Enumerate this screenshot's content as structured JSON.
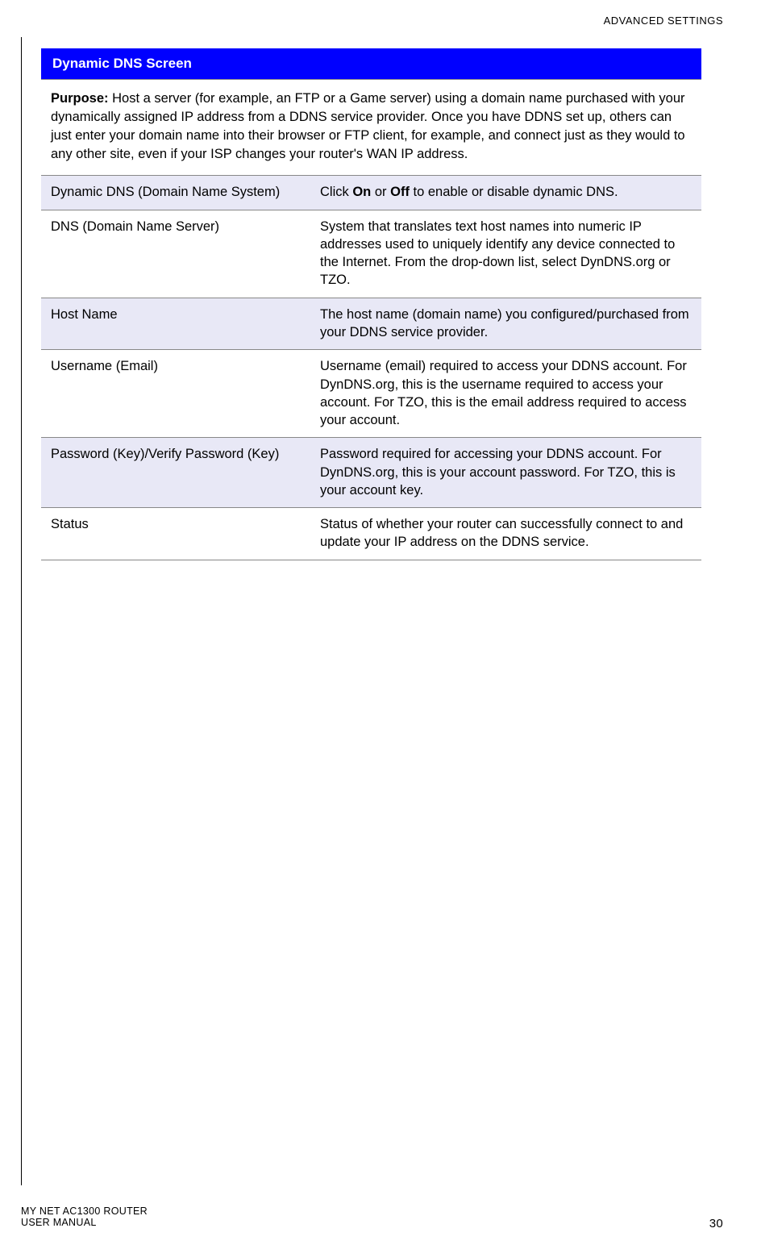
{
  "header": {
    "section": "ADVANCED SETTINGS"
  },
  "title": "Dynamic DNS Screen",
  "purpose": {
    "label": "Purpose:",
    "text": " Host a server (for example, an FTP or a Game server) using a domain name purchased with your dynamically assigned IP address from a DDNS service provider. Once you have DDNS set up, others can just enter your domain name into their browser or FTP client, for example, and connect just as they would to any other site, even if your ISP changes your router's WAN IP address."
  },
  "rows": [
    {
      "name": "Dynamic DNS (Domain Name System)",
      "desc_pre": "Click ",
      "desc_b1": "On",
      "desc_mid": " or ",
      "desc_b2": "Off",
      "desc_post": " to enable or disable dynamic DNS.",
      "shade": true
    },
    {
      "name": "DNS (Domain Name Server)",
      "desc": "System that translates text host names into numeric IP addresses used to uniquely identify any device connected to the Internet. From the drop-down list, select DynDNS.org or TZO.",
      "shade": false
    },
    {
      "name": "Host Name",
      "desc": "The host name (domain name) you configured/purchased from your DDNS service provider.",
      "shade": true
    },
    {
      "name": "Username (Email)",
      "desc": "Username (email) required to access your DDNS account. For DynDNS.org, this is the username required to access your account. For TZO, this is the email address required to access your account.",
      "shade": false
    },
    {
      "name": "Password (Key)/Verify Password (Key)",
      "desc": "Password required for accessing your DDNS account. For DynDNS.org, this is your account password. For TZO, this is your account key.",
      "shade": true
    },
    {
      "name": "Status",
      "desc": "Status of whether your router can successfully connect to and update your IP address on the DDNS service.",
      "shade": false
    }
  ],
  "footer": {
    "line1": "MY NET AC1300 ROUTER",
    "line2": "USER MANUAL",
    "page": "30"
  }
}
